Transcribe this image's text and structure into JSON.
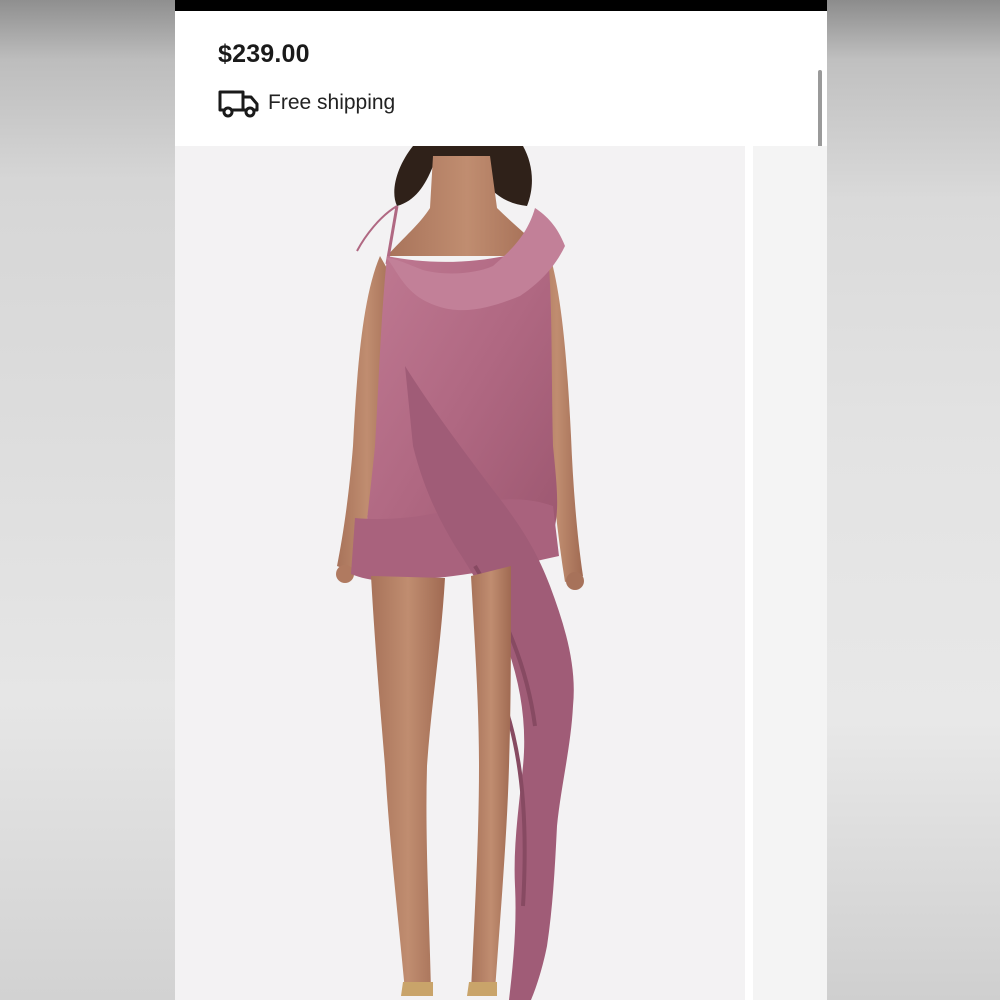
{
  "product": {
    "price": "$239.00",
    "shipping_label": "Free shipping",
    "shipping_icon": "truck-icon"
  },
  "gallery": {
    "main_image_subject": "model-in-ruffled-dress",
    "has_next_image_peek": true
  },
  "colors": {
    "dress": "#b56b86",
    "dress_shadow": "#8a4760",
    "skin": "#b98466",
    "hair": "#2f2119",
    "photo_background": "#f3f2f3",
    "price_text": "#1a1a1a"
  }
}
